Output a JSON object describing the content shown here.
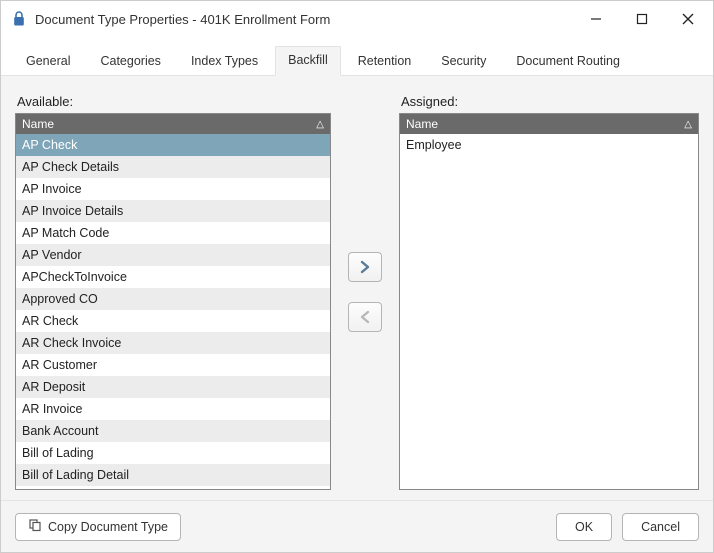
{
  "window": {
    "title": "Document Type Properties  - 401K Enrollment Form"
  },
  "tabs": [
    {
      "label": "General"
    },
    {
      "label": "Categories"
    },
    {
      "label": "Index Types"
    },
    {
      "label": "Backfill",
      "active": true
    },
    {
      "label": "Retention"
    },
    {
      "label": "Security"
    },
    {
      "label": "Document Routing"
    }
  ],
  "panels": {
    "available_label": "Available:",
    "assigned_label": "Assigned:",
    "column_header": "Name"
  },
  "available_items": [
    {
      "label": "AP Check",
      "selected": true
    },
    {
      "label": "AP Check Details"
    },
    {
      "label": "AP Invoice"
    },
    {
      "label": "AP Invoice Details"
    },
    {
      "label": "AP Match Code"
    },
    {
      "label": "AP Vendor"
    },
    {
      "label": "APCheckToInvoice"
    },
    {
      "label": "Approved CO"
    },
    {
      "label": "AR Check"
    },
    {
      "label": "AR Check Invoice"
    },
    {
      "label": "AR Customer"
    },
    {
      "label": "AR Deposit"
    },
    {
      "label": "AR Invoice"
    },
    {
      "label": "Bank Account"
    },
    {
      "label": "Bill of Lading"
    },
    {
      "label": "Bill of Lading Detail"
    }
  ],
  "assigned_items": [
    {
      "label": "Employee"
    }
  ],
  "buttons": {
    "copy": "Copy Document Type",
    "ok": "OK",
    "cancel": "Cancel"
  }
}
